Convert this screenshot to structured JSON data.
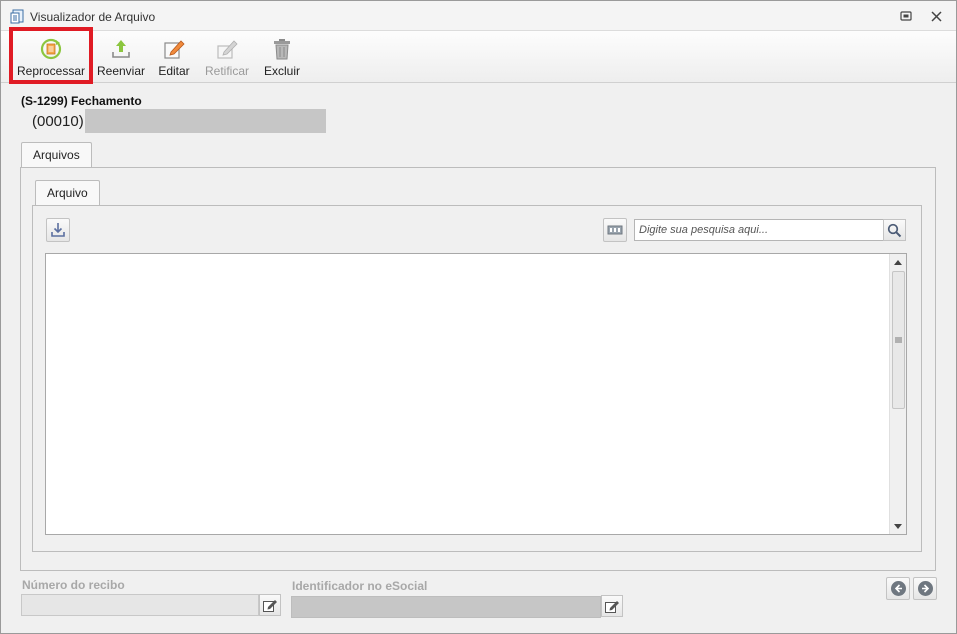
{
  "window": {
    "title": "Visualizador de Arquivo"
  },
  "toolbar": {
    "buttons": [
      {
        "label": "Reprocessar",
        "icon": "reprocess-icon",
        "enabled": true,
        "highlighted": true
      },
      {
        "label": "Reenviar",
        "icon": "upload-icon",
        "enabled": true
      },
      {
        "label": "Editar",
        "icon": "edit-icon",
        "enabled": true
      },
      {
        "label": "Retificar",
        "icon": "rectify-icon",
        "enabled": false
      },
      {
        "label": "Excluir",
        "icon": "trash-icon",
        "enabled": true
      }
    ]
  },
  "header": {
    "event_title": "(S-1299) Fechamento",
    "event_code": "(00010)"
  },
  "tabs": {
    "outer": "Arquivos",
    "inner": "Arquivo"
  },
  "search": {
    "placeholder": "Digite sua pesquisa aqui..."
  },
  "fields": {
    "recibo_label": "Número do recibo",
    "identificador_label": "Identificador no eSocial"
  },
  "colors": {
    "highlight": "#e01b24",
    "accent_green": "#8cc63f",
    "disabled_text": "#9a9a9a"
  }
}
